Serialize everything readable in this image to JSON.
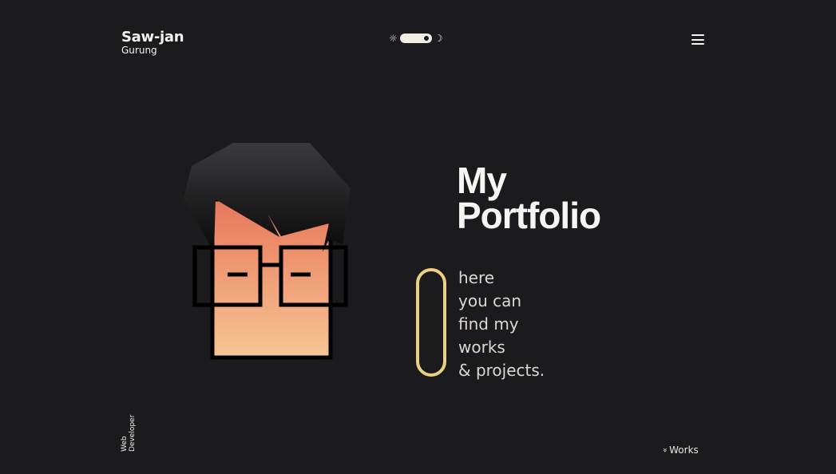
{
  "header": {
    "logo_first": "Saw-jan",
    "logo_last": "Gurung",
    "theme_toggle": {
      "sun_icon": "☼",
      "moon_icon": "☽",
      "mode": "dark"
    },
    "menu_icon": "hamburger-menu-icon"
  },
  "hero": {
    "title_line1": "My",
    "title_line2": "Portfolio",
    "tagline": [
      "here",
      "you can",
      "find my",
      "works",
      "& projects."
    ],
    "accent_color": "#eccf83"
  },
  "footer": {
    "role_line1": "Web",
    "role_line2": "Developer",
    "works_label": "Works",
    "works_icon": "»"
  },
  "colors": {
    "background": "#1b1b1e",
    "text": "#f5f3ef",
    "skin_top": "#e8765a",
    "skin_bottom": "#f7c694"
  }
}
